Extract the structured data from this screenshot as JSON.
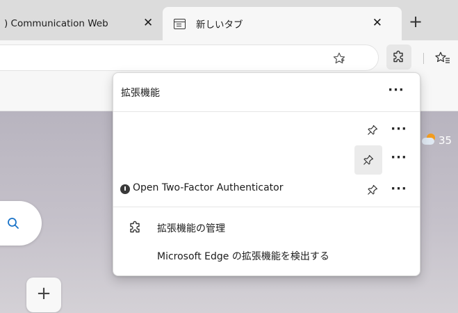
{
  "tabs": [
    {
      "title": ") Communication Web",
      "close": "✕"
    },
    {
      "title": "新しいタブ",
      "close": "✕"
    }
  ],
  "new_tab_label": "+",
  "weather": {
    "temperature": "35"
  },
  "extensions_menu": {
    "title": "拡張機能",
    "more_label": "···",
    "items": [
      {
        "name": ""
      },
      {
        "name": ""
      },
      {
        "name": "Open Two-Factor Authenticator"
      }
    ],
    "manage_label": "拡張機能の管理",
    "discover_label": "Microsoft Edge の拡張機能を検出する"
  },
  "add_shortcut_label": "+",
  "colors": {
    "accent": "#1a73c8",
    "menu_bg": "#ffffff",
    "page_bg": "#c1bdc7"
  }
}
